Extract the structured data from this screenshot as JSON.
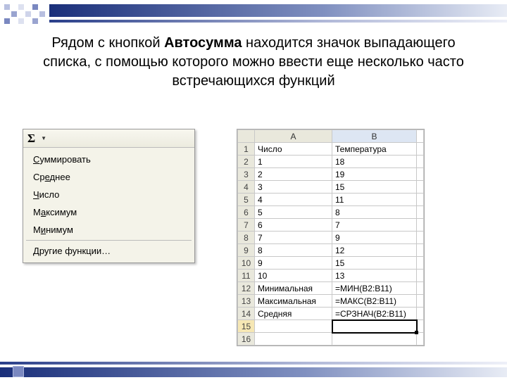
{
  "title": {
    "pre": "Рядом с кнопкой ",
    "bold": "Автосумма",
    "post": " находится значок выпадающего списка, с помощью которого можно ввести еще несколько часто встречающихся функций"
  },
  "menu": {
    "sigma": "Σ",
    "items": [
      {
        "pre": "",
        "u": "С",
        "post": "уммировать"
      },
      {
        "pre": "Ср",
        "u": "е",
        "post": "днее"
      },
      {
        "pre": "",
        "u": "Ч",
        "post": "исло"
      },
      {
        "pre": "М",
        "u": "а",
        "post": "ксимум"
      },
      {
        "pre": "М",
        "u": "и",
        "post": "нимум"
      },
      {
        "pre": "",
        "u": "Д",
        "post": "ругие функции…"
      }
    ]
  },
  "sheet": {
    "cols": [
      "A",
      "B"
    ],
    "rows": [
      {
        "n": "1",
        "a": "Число",
        "b": "Температура"
      },
      {
        "n": "2",
        "a": "1",
        "b": "18"
      },
      {
        "n": "3",
        "a": "2",
        "b": "19"
      },
      {
        "n": "4",
        "a": "3",
        "b": "15"
      },
      {
        "n": "5",
        "a": "4",
        "b": "11"
      },
      {
        "n": "6",
        "a": "5",
        "b": "8"
      },
      {
        "n": "7",
        "a": "6",
        "b": "7"
      },
      {
        "n": "8",
        "a": "7",
        "b": "9"
      },
      {
        "n": "9",
        "a": "8",
        "b": "12"
      },
      {
        "n": "10",
        "a": "9",
        "b": "15"
      },
      {
        "n": "11",
        "a": "10",
        "b": "13"
      },
      {
        "n": "12",
        "a": "Минимальная",
        "b": "=МИН(B2:B11)"
      },
      {
        "n": "13",
        "a": "Максимальная",
        "b": "=МАКС(B2:B11)"
      },
      {
        "n": "14",
        "a": "Средняя",
        "b": "=СРЗНАЧ(B2:B11)"
      },
      {
        "n": "15",
        "a": "",
        "b": ""
      },
      {
        "n": "16",
        "a": "",
        "b": ""
      }
    ],
    "selected_row": 15
  }
}
